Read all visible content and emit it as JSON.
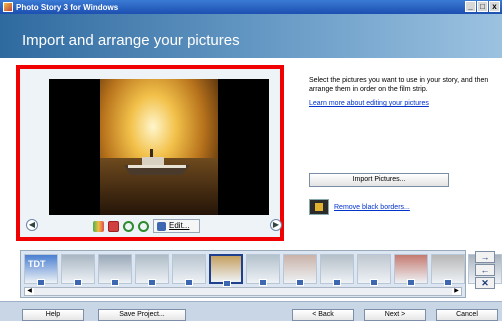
{
  "window": {
    "title": "Photo Story 3 for Windows"
  },
  "header": {
    "title": "Import and arrange your pictures"
  },
  "preview": {
    "edit_label": "Edit..."
  },
  "instructions": {
    "text": "Select the pictures you want to use in your story, and then arrange them in order on the film strip.",
    "learn_link": "Learn more about editing your pictures"
  },
  "actions": {
    "import_label": "Import Pictures...",
    "remove_borders_label": "Remove black borders..."
  },
  "filmstrip": {
    "thumbnails": [
      {
        "id": "tdt",
        "color": "#4a7fd0"
      },
      {
        "id": "t2",
        "color": "#a9b7c3"
      },
      {
        "id": "t3",
        "color": "#9aa8b8"
      },
      {
        "id": "t4",
        "color": "#aebbc6"
      },
      {
        "id": "t5",
        "color": "#b8c4cf"
      },
      {
        "id": "t6",
        "color": "#c4a060",
        "selected": true
      },
      {
        "id": "t7",
        "color": "#b3c1cc"
      },
      {
        "id": "t8",
        "color": "#c9b2a8"
      },
      {
        "id": "t9",
        "color": "#b4bfc8"
      },
      {
        "id": "t10",
        "color": "#bfc7cf"
      },
      {
        "id": "t11",
        "color": "#c47a70"
      },
      {
        "id": "t12",
        "color": "#b7b7b7"
      },
      {
        "id": "t13",
        "color": "#a8b2be"
      }
    ],
    "first_thumb_text": "TDT"
  },
  "nav": {
    "help": "Help",
    "save_project": "Save Project...",
    "back": "< Back",
    "next": "Next >",
    "cancel": "Cancel"
  }
}
